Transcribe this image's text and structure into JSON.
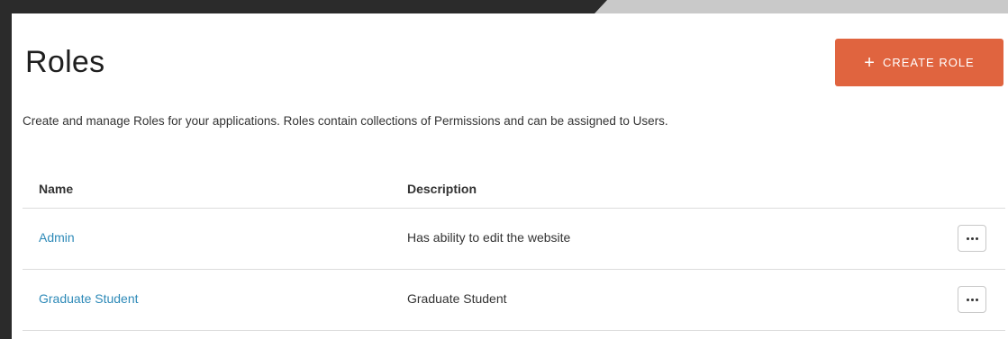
{
  "page": {
    "title": "Roles",
    "subtitle": "Create and manage Roles for your applications. Roles contain collections of Permissions and can be assigned to Users.",
    "create_button": {
      "icon": "plus-icon",
      "label": "CREATE ROLE"
    }
  },
  "table": {
    "columns": [
      "Name",
      "Description"
    ],
    "rows": [
      {
        "name": "Admin",
        "description": "Has ability to edit the website",
        "menu_icon": "more-horizontal-icon"
      },
      {
        "name": "Graduate Student",
        "description": "Graduate Student",
        "menu_icon": "more-horizontal-icon"
      }
    ]
  },
  "colors": {
    "accent": "#e0643f",
    "link": "#2e8ab8",
    "text": "#333333",
    "divider": "#dcdcdc"
  }
}
